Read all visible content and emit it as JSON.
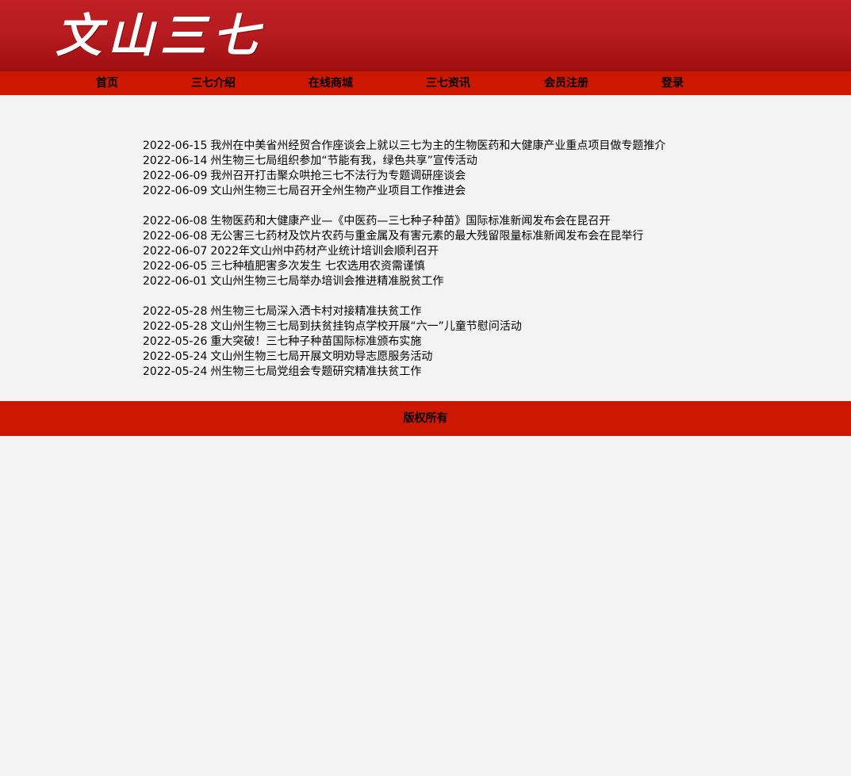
{
  "header": {
    "logo_text": "文山三七",
    "brand_color": "#b51b1f"
  },
  "nav": {
    "items": [
      {
        "label": "首页"
      },
      {
        "label": "三七介绍"
      },
      {
        "label": "在线商城"
      },
      {
        "label": "三七资讯"
      },
      {
        "label": "会员注册"
      },
      {
        "label": "登录"
      }
    ],
    "color": "#cc1800"
  },
  "news": {
    "groups": [
      {
        "items": [
          {
            "date": "2022-06-15",
            "title": "我州在中美省州经贸合作座谈会上就以三七为主的生物医药和大健康产业重点项目做专题推介"
          },
          {
            "date": "2022-06-14",
            "title": "州生物三七局组织参加“节能有我，绿色共享”宣传活动"
          },
          {
            "date": "2022-06-09",
            "title": "我州召开打击聚众哄抢三七不法行为专题调研座谈会"
          },
          {
            "date": "2022-06-09",
            "title": "文山州生物三七局召开全州生物产业项目工作推进会"
          }
        ]
      },
      {
        "items": [
          {
            "date": "2022-06-08",
            "title": "生物医药和大健康产业—《中医药—三七种子种苗》国际标准新闻发布会在昆召开"
          },
          {
            "date": "2022-06-08",
            "title": "无公害三七药材及饮片农药与重金属及有害元素的最大残留限量标准新闻发布会在昆举行"
          },
          {
            "date": "2022-06-07",
            "title": "2022年文山州中药材产业统计培训会顺利召开"
          },
          {
            "date": "2022-06-05",
            "title": "三七种植肥害多次发生 七农选用农资需谨慎"
          },
          {
            "date": "2022-06-01",
            "title": "文山州生物三七局举办培训会推进精准脱贫工作"
          }
        ]
      },
      {
        "items": [
          {
            "date": "2022-05-28",
            "title": "州生物三七局深入洒卡村对接精准扶贫工作"
          },
          {
            "date": "2022-05-28",
            "title": "文山州生物三七局到扶贫挂钩点学校开展“六一”儿童节慰问活动"
          },
          {
            "date": "2022-05-26",
            "title": "重大突破！三七种子种苗国际标准颁布实施"
          },
          {
            "date": "2022-05-24",
            "title": "文山州生物三七局开展文明劝导志愿服务活动"
          },
          {
            "date": "2022-05-24",
            "title": "州生物三七局党组会专题研究精准扶贫工作"
          }
        ]
      }
    ]
  },
  "footer": {
    "copyright": "版权所有"
  }
}
